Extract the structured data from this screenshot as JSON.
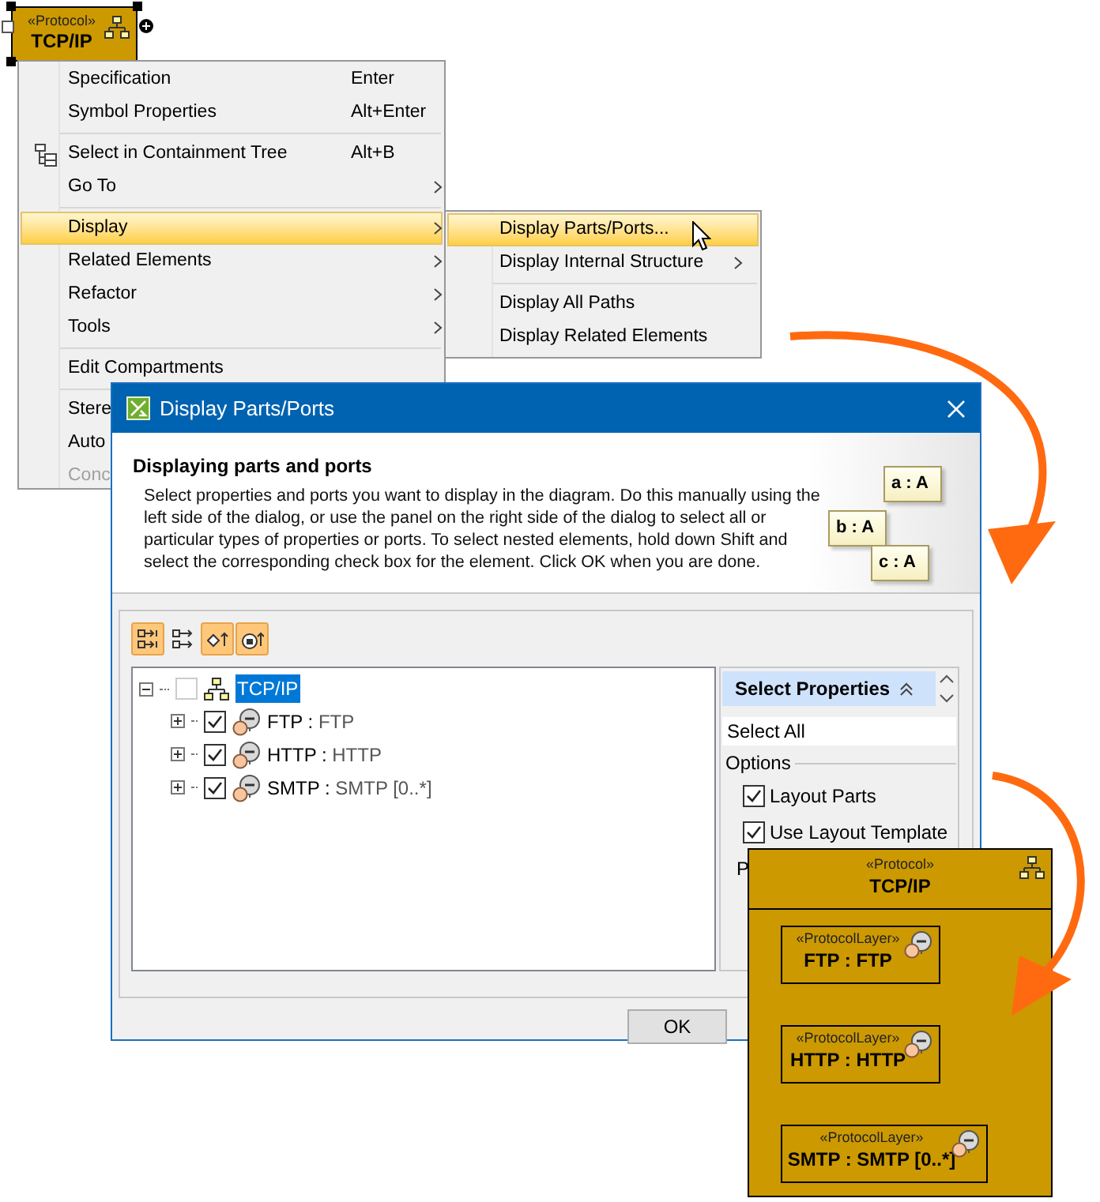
{
  "diagram_shape": {
    "stereotype": "«Protocol»",
    "name": "TCP/IP",
    "selected": true
  },
  "context_menu": {
    "sections": [
      [
        {
          "label": "Specification",
          "shortcut": "Enter",
          "kind": "text",
          "submenu": false,
          "selected": false,
          "disabled": false
        },
        {
          "label": "Symbol Properties",
          "shortcut": "Alt+Enter",
          "kind": "text",
          "submenu": false,
          "selected": false,
          "disabled": false
        }
      ],
      [
        {
          "label": "Select in Containment Tree",
          "shortcut": "Alt+B",
          "kind": "icon",
          "submenu": false,
          "selected": false,
          "disabled": false
        },
        {
          "label": "Go To",
          "kind": "text",
          "submenu": true,
          "selected": false,
          "disabled": false
        }
      ],
      [
        {
          "label": "Display",
          "kind": "text",
          "submenu": true,
          "selected": true,
          "disabled": false
        },
        {
          "label": "Related Elements",
          "kind": "text",
          "submenu": true,
          "selected": false,
          "disabled": false
        },
        {
          "label": "Refactor",
          "kind": "text",
          "submenu": true,
          "selected": false,
          "disabled": false
        },
        {
          "label": "Tools",
          "kind": "text",
          "submenu": true,
          "selected": false,
          "disabled": false
        }
      ],
      [
        {
          "label": "Edit Compartments",
          "kind": "text",
          "submenu": false,
          "selected": false,
          "disabled": false
        }
      ],
      [
        {
          "label": "Stere",
          "kind": "text",
          "selected": false,
          "disabled": false
        },
        {
          "label": "Auto",
          "kind": "text",
          "selected": false,
          "disabled": false
        },
        {
          "label": "Conc",
          "kind": "text",
          "selected": false,
          "disabled": true
        }
      ]
    ]
  },
  "submenu": {
    "sections": [
      [
        {
          "label": "Display Parts/Ports...",
          "submenu": false,
          "selected": true
        },
        {
          "label": "Display Internal Structure",
          "submenu": true,
          "selected": false
        }
      ],
      [
        {
          "label": "Display All Paths",
          "submenu": false,
          "selected": false
        },
        {
          "label": "Display Related Elements",
          "submenu": false,
          "selected": false
        }
      ]
    ]
  },
  "dialog": {
    "title": "Display Parts/Ports",
    "heading": "Displaying parts and ports",
    "description": "Select properties and ports you want to display in the diagram. Do this manually using the left side of the dialog, or use the panel on the right side of the dialog to select all or particular types of properties or ports. To select nested elements, hold down Shift and select the corresponding check box for the element. Click OK when you are done.",
    "illustration": [
      "a : A",
      "b : A",
      "c : A"
    ],
    "toolbar": [
      {
        "selected": true
      },
      {
        "selected": false
      },
      {
        "selected": true
      },
      {
        "selected": true
      }
    ],
    "tree": {
      "label": "TCP/IP",
      "checked": false,
      "expanded": true,
      "selected": true,
      "children": [
        {
          "name": "FTP :",
          "type": "FTP",
          "checked": true,
          "expanded": false
        },
        {
          "name": "HTTP :",
          "type": "HTTP",
          "checked": true,
          "expanded": false
        },
        {
          "name": "SMTP :",
          "type": "SMTP [0..*]",
          "checked": true,
          "expanded": false
        }
      ]
    },
    "side_panel": {
      "title": "Select Properties",
      "select_all": "Select All",
      "options_label": "Options",
      "options": [
        {
          "label": "Layout Parts",
          "checked": true
        },
        {
          "label": "Use Layout Template",
          "checked": true
        }
      ],
      "more": "P"
    },
    "buttons": [
      "OK"
    ]
  },
  "result_shape": {
    "stereotype": "«Protocol»",
    "name": "TCP/IP",
    "parts": [
      {
        "stereotype": "«ProtocolLayer»",
        "label": "FTP : FTP"
      },
      {
        "stereotype": "«ProtocolLayer»",
        "label": "HTTP : HTTP"
      },
      {
        "stereotype": "«ProtocolLayer»",
        "label": "SMTP : SMTP [0..*]"
      }
    ]
  }
}
